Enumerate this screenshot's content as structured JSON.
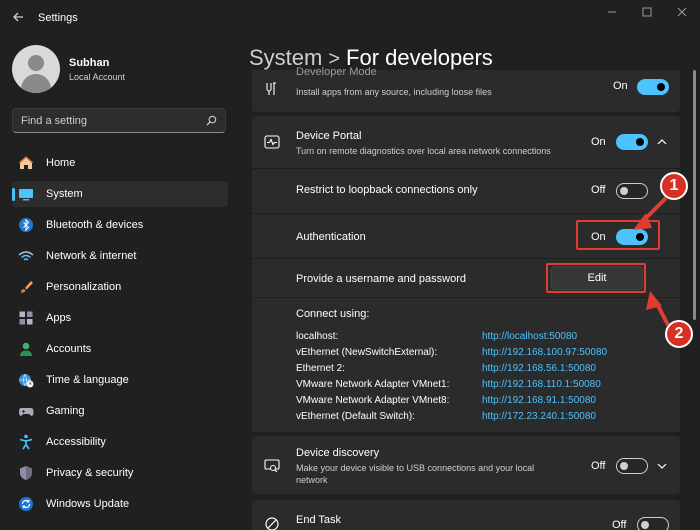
{
  "window": {
    "title": "Settings"
  },
  "user": {
    "name": "Subhan",
    "account_type": "Local Account"
  },
  "search": {
    "placeholder": "Find a setting"
  },
  "nav": [
    {
      "label": "Home",
      "icon": "home-icon"
    },
    {
      "label": "System",
      "icon": "system-icon",
      "active": true
    },
    {
      "label": "Bluetooth & devices",
      "icon": "bluetooth-icon"
    },
    {
      "label": "Network & internet",
      "icon": "network-icon"
    },
    {
      "label": "Personalization",
      "icon": "brush-icon"
    },
    {
      "label": "Apps",
      "icon": "apps-icon"
    },
    {
      "label": "Accounts",
      "icon": "accounts-icon"
    },
    {
      "label": "Time & language",
      "icon": "globe-clock-icon"
    },
    {
      "label": "Gaming",
      "icon": "gamepad-icon"
    },
    {
      "label": "Accessibility",
      "icon": "accessibility-icon"
    },
    {
      "label": "Privacy & security",
      "icon": "shield-icon"
    },
    {
      "label": "Windows Update",
      "icon": "update-icon"
    }
  ],
  "breadcrumb": {
    "parent": "System",
    "separator": ">",
    "current": "For developers"
  },
  "developer_mode": {
    "title": "Developer Mode",
    "description": "Install apps from any source, including loose files",
    "state": "On"
  },
  "device_portal": {
    "title": "Device Portal",
    "description": "Turn on remote diagnostics over local area network connections",
    "state": "On",
    "restrict_loopback": {
      "label": "Restrict to loopback connections only",
      "state": "Off"
    },
    "authentication": {
      "label": "Authentication",
      "state": "On"
    },
    "credentials": {
      "label": "Provide a username and password",
      "button": "Edit"
    },
    "connect_using": {
      "title": "Connect using:",
      "connections": [
        {
          "name": "localhost:",
          "url": "http://localhost:50080"
        },
        {
          "name": "vEthernet (NewSwitchExternal):",
          "url": "http://192.168.100.97:50080"
        },
        {
          "name": "Ethernet 2:",
          "url": "http://192.168.56.1:50080"
        },
        {
          "name": "VMware Network Adapter VMnet1:",
          "url": "http://192.168.110.1:50080"
        },
        {
          "name": "VMware Network Adapter VMnet8:",
          "url": "http://192.168.91.1:50080"
        },
        {
          "name": "vEthernet (Default Switch):",
          "url": "http://172.23.240.1:50080"
        }
      ]
    }
  },
  "device_discovery": {
    "title": "Device discovery",
    "description": "Make your device visible to USB connections and your local network",
    "state": "Off"
  },
  "end_task": {
    "title": "End Task",
    "state": "Off"
  },
  "annotations": {
    "one": "1",
    "two": "2"
  },
  "colors": {
    "accent": "#4cc2ff",
    "annotation": "#e03c31",
    "background": "#202020",
    "card": "#2b2b2b"
  }
}
